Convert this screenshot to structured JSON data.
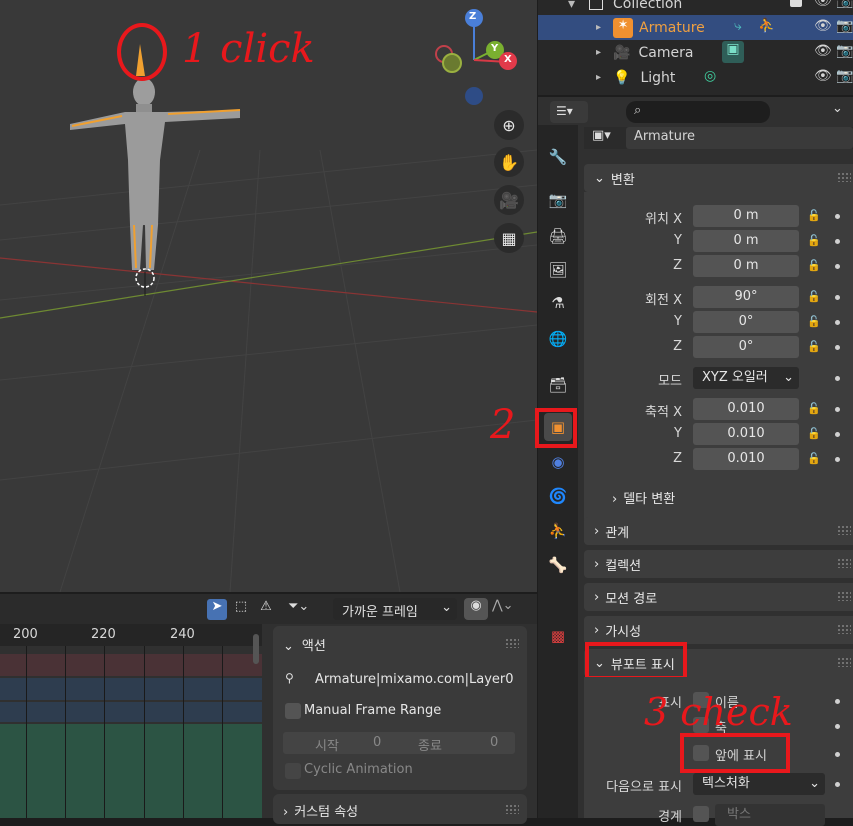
{
  "viewport": {
    "gizmo": {
      "z": "Z",
      "y": "Y",
      "x": "X"
    },
    "nav_icons": [
      "zoom-icon",
      "hand-icon",
      "camera-icon",
      "grid-icon"
    ]
  },
  "annotations": {
    "step1": "1 click",
    "step2": "2",
    "step3": "3 check"
  },
  "outliner": {
    "collection": "Collection",
    "items": [
      {
        "label": "Armature",
        "selected": true
      },
      {
        "label": "Camera",
        "selected": false
      },
      {
        "label": "Light",
        "selected": false
      }
    ]
  },
  "properties": {
    "search_placeholder": "",
    "object_name": "Armature",
    "transform": {
      "header": "변환",
      "location_label": "위치 X",
      "rotation_label": "회전 X",
      "scale_label": "축적 X",
      "y": "Y",
      "z": "Z",
      "location": [
        "0 m",
        "0 m",
        "0 m"
      ],
      "rotation": [
        "90°",
        "0°",
        "0°"
      ],
      "mode_label": "모드",
      "mode_value": "XYZ 오일러",
      "scale": [
        "0.010",
        "0.010",
        "0.010"
      ],
      "delta": "델타 변환"
    },
    "sections": [
      "관계",
      "컬렉션",
      "모션 경로",
      "가시성"
    ],
    "viewport_display": {
      "header": "뷰포트 표시",
      "show_label": "표시",
      "name_cb": "이름",
      "axes_cb": "축",
      "in_front_cb": "앞에 표시",
      "display_as_label": "다음으로 표시",
      "display_as_value": "텍스처화",
      "bounds_label": "경계",
      "bounds_value": "박스"
    }
  },
  "timeline": {
    "snap_value": "가까운 프레임",
    "ruler": [
      "200",
      "220",
      "240"
    ],
    "action_panel": {
      "header": "액션",
      "action_name": "Armature|mixamo.com|Layer0",
      "manual_frame_range": "Manual Frame Range",
      "start_label": "시작",
      "start_value": "0",
      "end_label": "종료",
      "end_value": "0",
      "cyclic": "Cyclic Animation"
    },
    "custom_props": "커스텀 속성"
  }
}
